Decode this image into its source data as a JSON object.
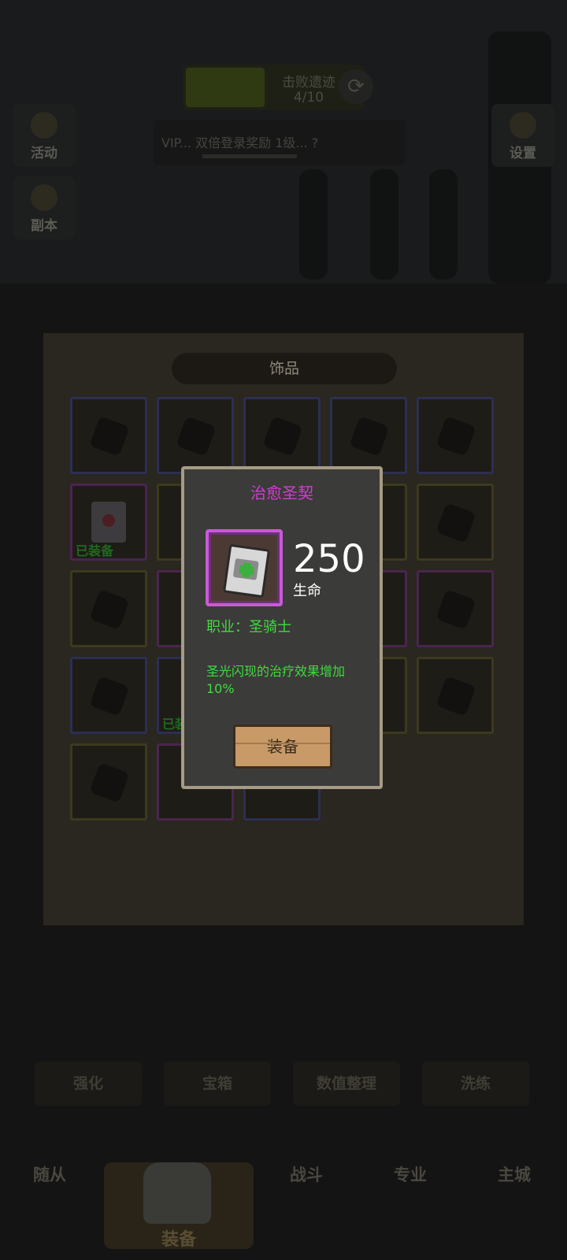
{
  "background": {
    "quest": {
      "title": "击败遗迹",
      "progress": "4/10"
    },
    "ticker": "VIP... 双倍登录奖励 1级... ?",
    "left_buttons": [
      {
        "label": "活动",
        "icon": "star-icon"
      },
      {
        "label": "副本",
        "icon": "door-icon"
      }
    ],
    "right_buttons": [
      {
        "label": "设置",
        "icon": "gear-icon"
      }
    ],
    "bottom_tabs": [
      "强化",
      "宝箱",
      "数值整理",
      "洗练"
    ],
    "nav": {
      "left": "随从",
      "center": "装备",
      "battle": "战斗",
      "skills": "专业",
      "city": "主城"
    }
  },
  "inventory": {
    "title": "饰品",
    "equipped_label": "已装备"
  },
  "item_detail": {
    "name": "治愈圣契",
    "name_color": "#d33cd3",
    "stat_value": "250",
    "stat_label": "生命",
    "class_line": "职业：圣骑士",
    "effect": "圣光闪现的治疗效果增加10%",
    "effect_color": "#3fdc3f",
    "equip_button": "装备",
    "icon": "holy-book-icon",
    "rarity_border_color": "#c85ad7"
  }
}
